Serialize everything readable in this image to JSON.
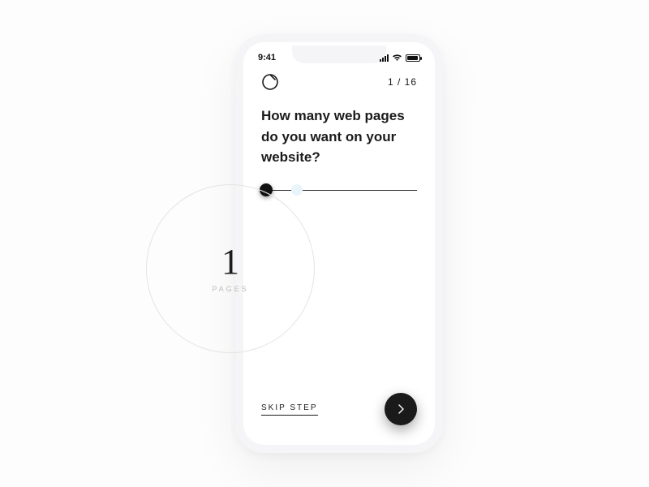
{
  "statusbar": {
    "time": "9:41"
  },
  "header": {
    "progress_current": "1",
    "progress_sep": " / ",
    "progress_total": "16"
  },
  "question": "How many web pages do you want on your website?",
  "slider": {
    "value": "1",
    "unit": "PAGES"
  },
  "footer": {
    "skip_label": "SKIP STEP"
  },
  "icons": {
    "logo": "circle-slash-logo",
    "next": "chevron-right-icon",
    "signal": "cellular-signal-icon",
    "wifi": "wifi-icon",
    "battery": "battery-full-icon"
  },
  "colors": {
    "ink": "#1a1a1a",
    "ring": "#e4e4e4",
    "accentSoft": "#eaf4fb"
  }
}
